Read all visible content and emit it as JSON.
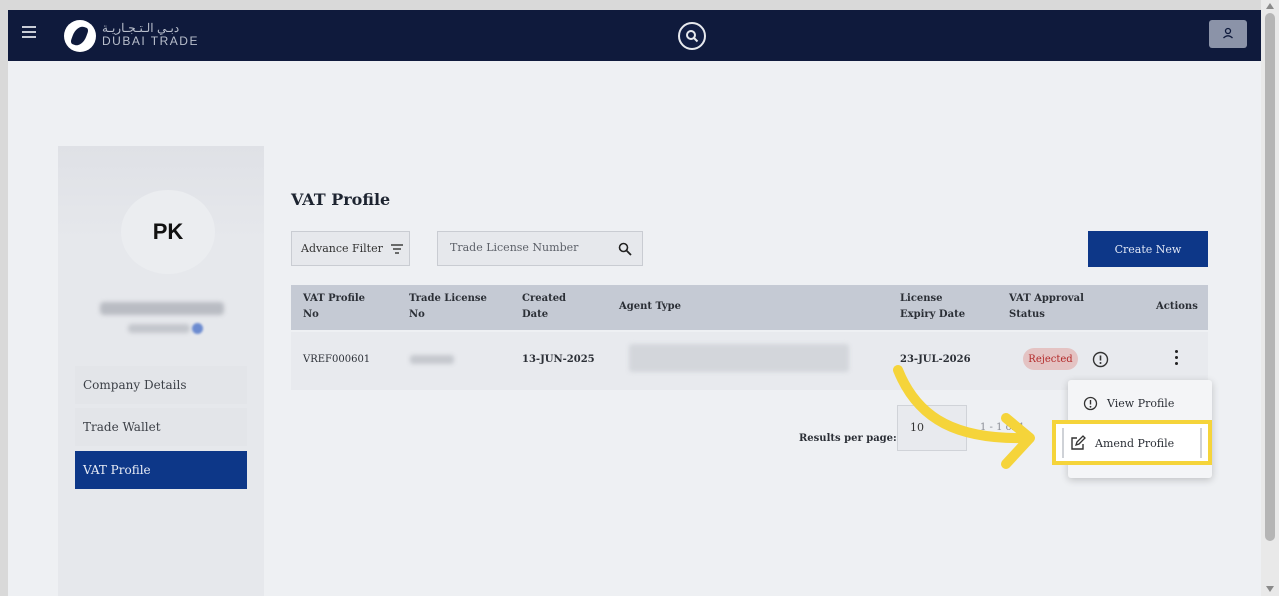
{
  "header": {
    "logo_ar": "دبـي الـتـجـاريـة",
    "logo_en": "DUBAI TRADE"
  },
  "sidebar": {
    "avatar_initials": "PK",
    "items": [
      {
        "label": "Company Details"
      },
      {
        "label": "Trade Wallet"
      },
      {
        "label": "VAT Profile"
      }
    ]
  },
  "main": {
    "title": "VAT Profile",
    "filter_label": "Advance Filter",
    "search_placeholder": "Trade License Number",
    "create_label": "Create New"
  },
  "table": {
    "columns": [
      "VAT Profile No",
      "Trade License No",
      "Created Date",
      "Agent Type",
      "License Expiry Date",
      "VAT Approval Status",
      "Actions"
    ],
    "rows": [
      {
        "vat_profile_no": "VREF000601",
        "created_date": "13-JUN-2025",
        "license_expiry_date": "23-JUL-2026",
        "status": "Rejected"
      }
    ]
  },
  "pagination": {
    "results_label": "Results per page:",
    "per_page": "10",
    "range": "1 - 1 of 1"
  },
  "row_menu": {
    "items": [
      {
        "label": "View Profile",
        "icon": "info-icon"
      },
      {
        "label": "Amend Profile",
        "icon": "edit-icon"
      }
    ]
  },
  "colors": {
    "topbar": "#0f1a3c",
    "accent": "#0d3788",
    "highlight": "#f5d43a",
    "rejected": "#b32a2a"
  }
}
